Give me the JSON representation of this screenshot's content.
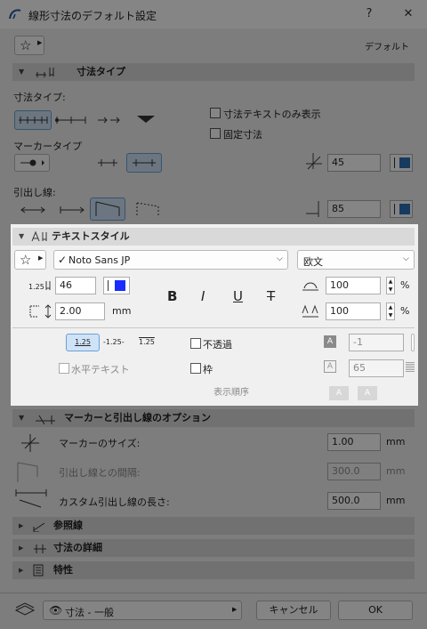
{
  "window": {
    "title": "線形寸法のデフォルト設定",
    "help": "?",
    "close": "✕"
  },
  "top": {
    "default_label": "デフォルト"
  },
  "sections": {
    "dim_type": "寸法タイプ",
    "text_style": "テキストスタイル",
    "marker_options": "マーカーと引出し線のオプション",
    "reference": "参照線",
    "details": "寸法の詳細",
    "properties": "特性"
  },
  "dim_type": {
    "type_label": "寸法タイプ:",
    "marker_label": "マーカータイプ",
    "leader_label": "引出し線:",
    "text_only": "寸法テキストのみ表示",
    "fixed": "固定寸法",
    "marker_size": "45",
    "leader_size": "85"
  },
  "text_style": {
    "font": "Noto Sans JP",
    "script": "欧文",
    "size_unit_icon": "1.25",
    "size": "46",
    "spacing": "2.00",
    "spacing_unit": "mm",
    "width_pct": "100",
    "spacing_pct": "100",
    "pct": "%",
    "bold": "B",
    "italic": "I",
    "underline": "U",
    "strike": "T",
    "pos1": "1.25",
    "pos2": "-1.25-",
    "pos3": "1.25",
    "horizontal_text": "水平テキスト",
    "opaque": "不透過",
    "frame": "枠",
    "display_order": "表示順序",
    "bg_pen": "-1",
    "frame_pen": "65",
    "text_color": "#1a2cff"
  },
  "marker_options": {
    "marker_size_label": "マーカーのサイズ:",
    "marker_size": "1.00",
    "gap_label": "引出し線との間隔:",
    "gap": "300.0",
    "custom_len_label": "カスタム引出し線の長さ:",
    "custom_len": "500.0",
    "unit": "mm"
  },
  "footer": {
    "layer": "寸法 - 一般",
    "cancel": "キャンセル",
    "ok": "OK"
  },
  "colors": {
    "accent": "#2d6fb8",
    "swatch_blue": "#1a2cff"
  }
}
